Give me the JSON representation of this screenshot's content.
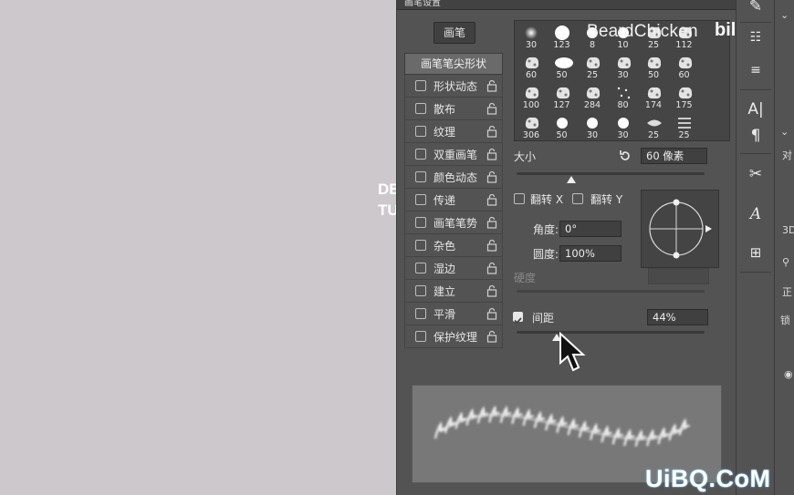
{
  "canvas": {
    "text_line1": "DE",
    "text_line2": "TU"
  },
  "panel": {
    "tab_title": "画笔设置",
    "brush_button": "画笔",
    "option_header": "画笔笔尖形状",
    "options": [
      {
        "label": "形状动态"
      },
      {
        "label": "散布"
      },
      {
        "label": "纹理"
      },
      {
        "label": "双重画笔"
      },
      {
        "label": "颜色动态"
      },
      {
        "label": "传递"
      },
      {
        "label": "画笔笔势"
      },
      {
        "label": "杂色"
      },
      {
        "label": "湿边"
      },
      {
        "label": "建立"
      },
      {
        "label": "平滑"
      },
      {
        "label": "保护纹理"
      }
    ],
    "preset_sizes": [
      "30",
      "123",
      "8",
      "10",
      "25",
      "112",
      "60",
      "50",
      "25",
      "30",
      "50",
      "60",
      "100",
      "127",
      "284",
      "80",
      "174",
      "175",
      "306",
      "50",
      "30",
      "30",
      "25",
      "25"
    ],
    "size_label": "大小",
    "size_value": "60 像素",
    "flip_x": "翻转 X",
    "flip_y": "翻转 Y",
    "angle_label": "角度:",
    "angle_value": "0°",
    "roundness_label": "圆度:",
    "roundness_value": "100%",
    "hardness_label": "硬度",
    "spacing_label": "间距",
    "spacing_value": "44%",
    "spacing_checked": true
  },
  "watermarks": {
    "channel": "BeardChicken",
    "site_logo": "bilibili",
    "uibq": "UiBQ.CoM"
  },
  "right_panel": {
    "label_dui": "对",
    "label_3d": "3D",
    "label_zheng": "正",
    "label_suo": "锁"
  },
  "colors": {
    "panel_bg": "#535353",
    "canvas_bg": "#cdc8cc",
    "preview_bg": "#787878"
  }
}
